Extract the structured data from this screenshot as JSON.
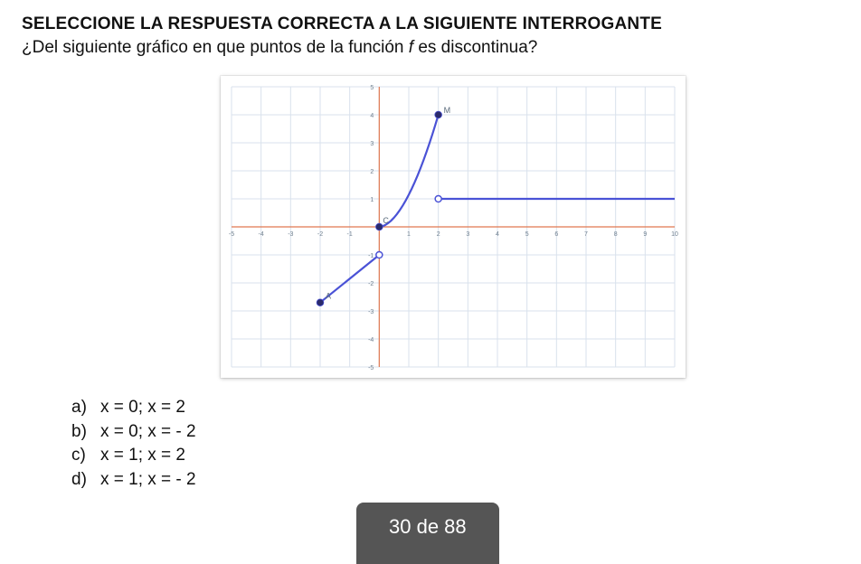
{
  "title": "SELECCIONE LA RESPUESTA CORRECTA A LA SIGUIENTE INTERROGANTE",
  "subtitle_pre": "¿Del siguiente gráfico en que puntos de la función ",
  "subtitle_fn": "f",
  "subtitle_post": " es discontinua?",
  "options": {
    "a": {
      "letter": "a)",
      "text": "x = 0; x = 2"
    },
    "b": {
      "letter": "b)",
      "text": "x = 0; x = - 2"
    },
    "c": {
      "letter": "c)",
      "text": "x = 1; x = 2"
    },
    "d": {
      "letter": "d)",
      "text": "x = 1; x = - 2"
    }
  },
  "page_badge": "30 de 88",
  "chart_data": {
    "type": "line",
    "xlim": [
      -5,
      10
    ],
    "ylim": [
      -5,
      5
    ],
    "xticks": [
      -5,
      -4,
      -3,
      -2,
      -1,
      0,
      1,
      2,
      3,
      4,
      5,
      6,
      7,
      8,
      9,
      10
    ],
    "yticks": [
      -5,
      -4,
      -3,
      -2,
      -1,
      0,
      1,
      2,
      3,
      4,
      5
    ],
    "series": [
      {
        "name": "segment_left",
        "x": [
          -2,
          0
        ],
        "y": [
          -2.7,
          -1
        ],
        "start_closed": true,
        "end_open": true
      },
      {
        "name": "segment_mid",
        "x": [
          0,
          2
        ],
        "y": [
          0,
          4
        ],
        "start_closed": true,
        "end_closed": true,
        "curved": true
      },
      {
        "name": "segment_right",
        "x": [
          2,
          10
        ],
        "y": [
          1,
          1
        ],
        "start_open": true
      }
    ],
    "labeled_points": [
      {
        "name": "A",
        "x": -2,
        "y": -2.7,
        "label_dx": 6,
        "label_dy": -4
      },
      {
        "name": "C",
        "x": 0,
        "y": 0,
        "label_dx": 4,
        "label_dy": -4
      },
      {
        "name": "M",
        "x": 2,
        "y": 4,
        "label_dx": 6,
        "label_dy": -2
      }
    ],
    "colors": {
      "grid_minor": "#d9e2ec",
      "grid_major": "#b9c6d6",
      "axis": "#e07850",
      "curve": "#4a52d6",
      "tick_text": "#708090"
    }
  }
}
